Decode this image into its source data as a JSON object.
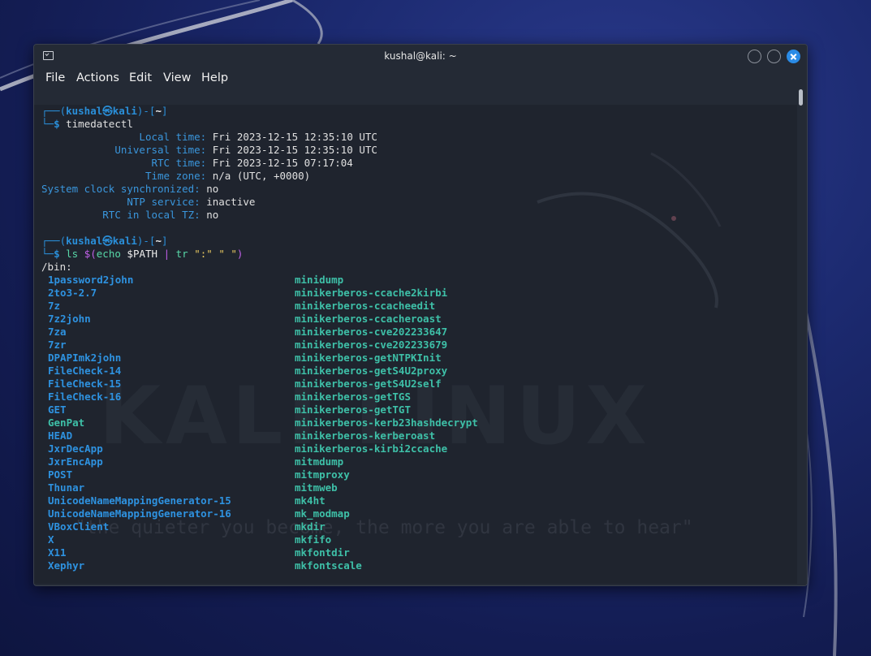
{
  "window": {
    "title": "kushal@kali: ~"
  },
  "menu": [
    "File",
    "Actions",
    "Edit",
    "View",
    "Help"
  ],
  "prompt": {
    "user": "kushal",
    "host": "kali",
    "dir": "~"
  },
  "commands": {
    "first": "timedatectl",
    "second": {
      "ls": "ls",
      "subst_open": "$(",
      "echo": "echo",
      "var": " $PATH ",
      "pipe": "|",
      "tr": " tr ",
      "args": "\":\" \" \"",
      "close": ")"
    }
  },
  "timedatectl": [
    {
      "key": "Local time:",
      "value": "Fri 2023-12-15 12:35:10 UTC"
    },
    {
      "key": "Universal time:",
      "value": "Fri 2023-12-15 12:35:10 UTC"
    },
    {
      "key": "RTC time:",
      "value": "Fri 2023-12-15 07:17:04"
    },
    {
      "key": "Time zone:",
      "value": "n/a (UTC, +0000)"
    },
    {
      "key": "System clock synchronized:",
      "value": "no"
    },
    {
      "key": "NTP service:",
      "value": "inactive"
    },
    {
      "key": "RTC in local TZ:",
      "value": "no"
    }
  ],
  "dir_header": "/bin:",
  "listing_col1": [
    "1password2john",
    "2to3-2.7",
    "7z",
    "7z2john",
    "7za",
    "7zr",
    "DPAPImk2john",
    "FileCheck-14",
    "FileCheck-15",
    "FileCheck-16",
    "GET",
    "GenPat",
    "HEAD",
    "JxrDecApp",
    "JxrEncApp",
    "POST",
    "Thunar",
    "UnicodeNameMappingGenerator-15",
    "UnicodeNameMappingGenerator-16",
    "VBoxClient",
    "X",
    "X11",
    "Xephyr"
  ],
  "listing_col1_green": [
    false,
    false,
    false,
    false,
    false,
    false,
    false,
    false,
    false,
    false,
    false,
    true,
    false,
    false,
    false,
    false,
    false,
    false,
    false,
    false,
    false,
    false,
    false
  ],
  "listing_col2": [
    "minidump",
    "minikerberos-ccache2kirbi",
    "minikerberos-ccacheedit",
    "minikerberos-ccacheroast",
    "minikerberos-cve202233647",
    "minikerberos-cve202233679",
    "minikerberos-getNTPKInit",
    "minikerberos-getS4U2proxy",
    "minikerberos-getS4U2self",
    "minikerberos-getTGS",
    "minikerberos-getTGT",
    "minikerberos-kerb23hashdecrypt",
    "minikerberos-kerberoast",
    "minikerberos-kirbi2ccache",
    "mitmdump",
    "mitmproxy",
    "mitmweb",
    "mk4ht",
    "mk_modmap",
    "mkdir",
    "mkfifo",
    "mkfontdir",
    "mkfontscale"
  ],
  "watermark": {
    "logo": "KALI LINUX",
    "quote": "\"the quieter you become, the more you are able to hear\""
  }
}
